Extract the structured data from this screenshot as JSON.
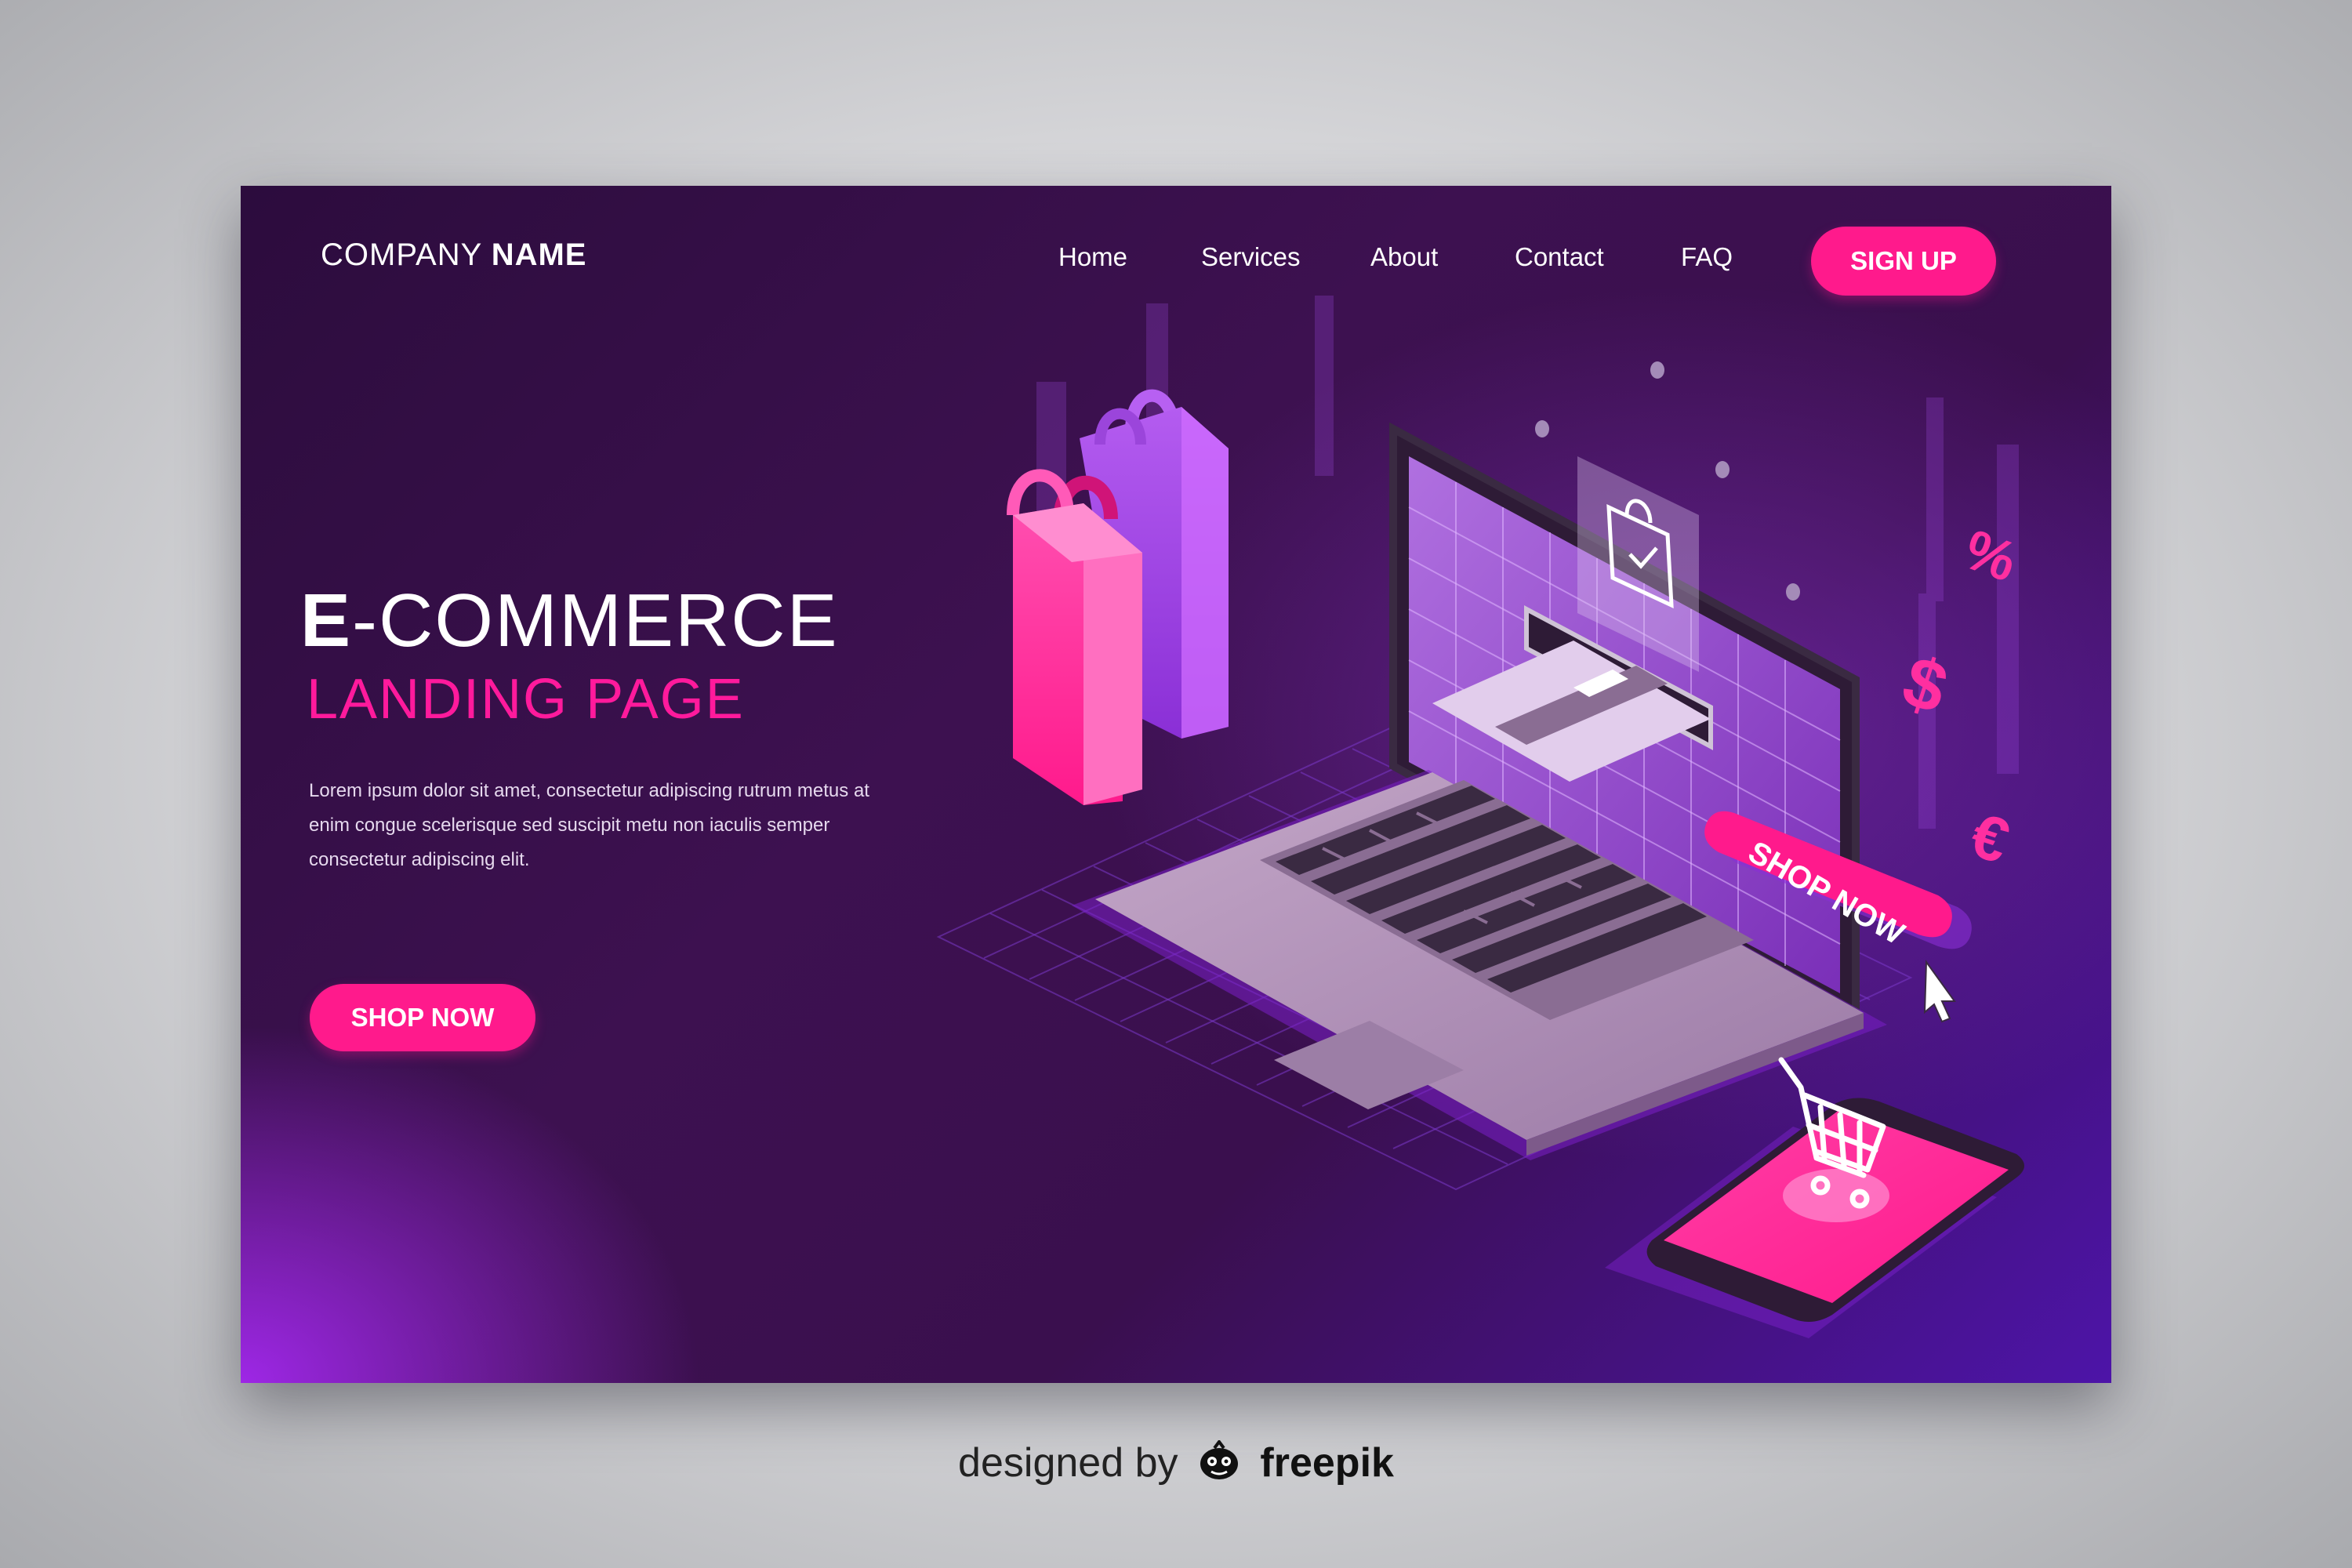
{
  "logo": {
    "light": "COMPANY",
    "bold": "NAME"
  },
  "nav": {
    "items": [
      "Home",
      "Services",
      "About",
      "Contact",
      "FAQ"
    ],
    "signup_label": "SIGN UP"
  },
  "hero": {
    "title_first": "E",
    "title_rest": "-COMMERCE",
    "subtitle": "LANDING PAGE",
    "description": "Lorem ipsum dolor sit amet, consectetur adipiscing rutrum metus at enim congue scelerisque sed suscipit metu non iaculis semper consectetur adipiscing elit.",
    "cta_label": "SHOP NOW"
  },
  "illustration": {
    "screen_badge": "SHOP NOW",
    "symbols": [
      "%",
      "$",
      "€"
    ],
    "icons": [
      "shopping-bag-pink-icon",
      "shopping-bag-purple-icon",
      "laptop-icon",
      "credit-card-icon",
      "bag-check-icon",
      "shopping-cart-icon",
      "smartphone-icon",
      "mouse-pointer-icon"
    ]
  },
  "footer": {
    "prefix": "designed by",
    "brand": "freepik"
  },
  "colors": {
    "accent": "#ff1a8c",
    "background_dark": "#2c0c3d",
    "background_purple": "#4d14a8"
  }
}
